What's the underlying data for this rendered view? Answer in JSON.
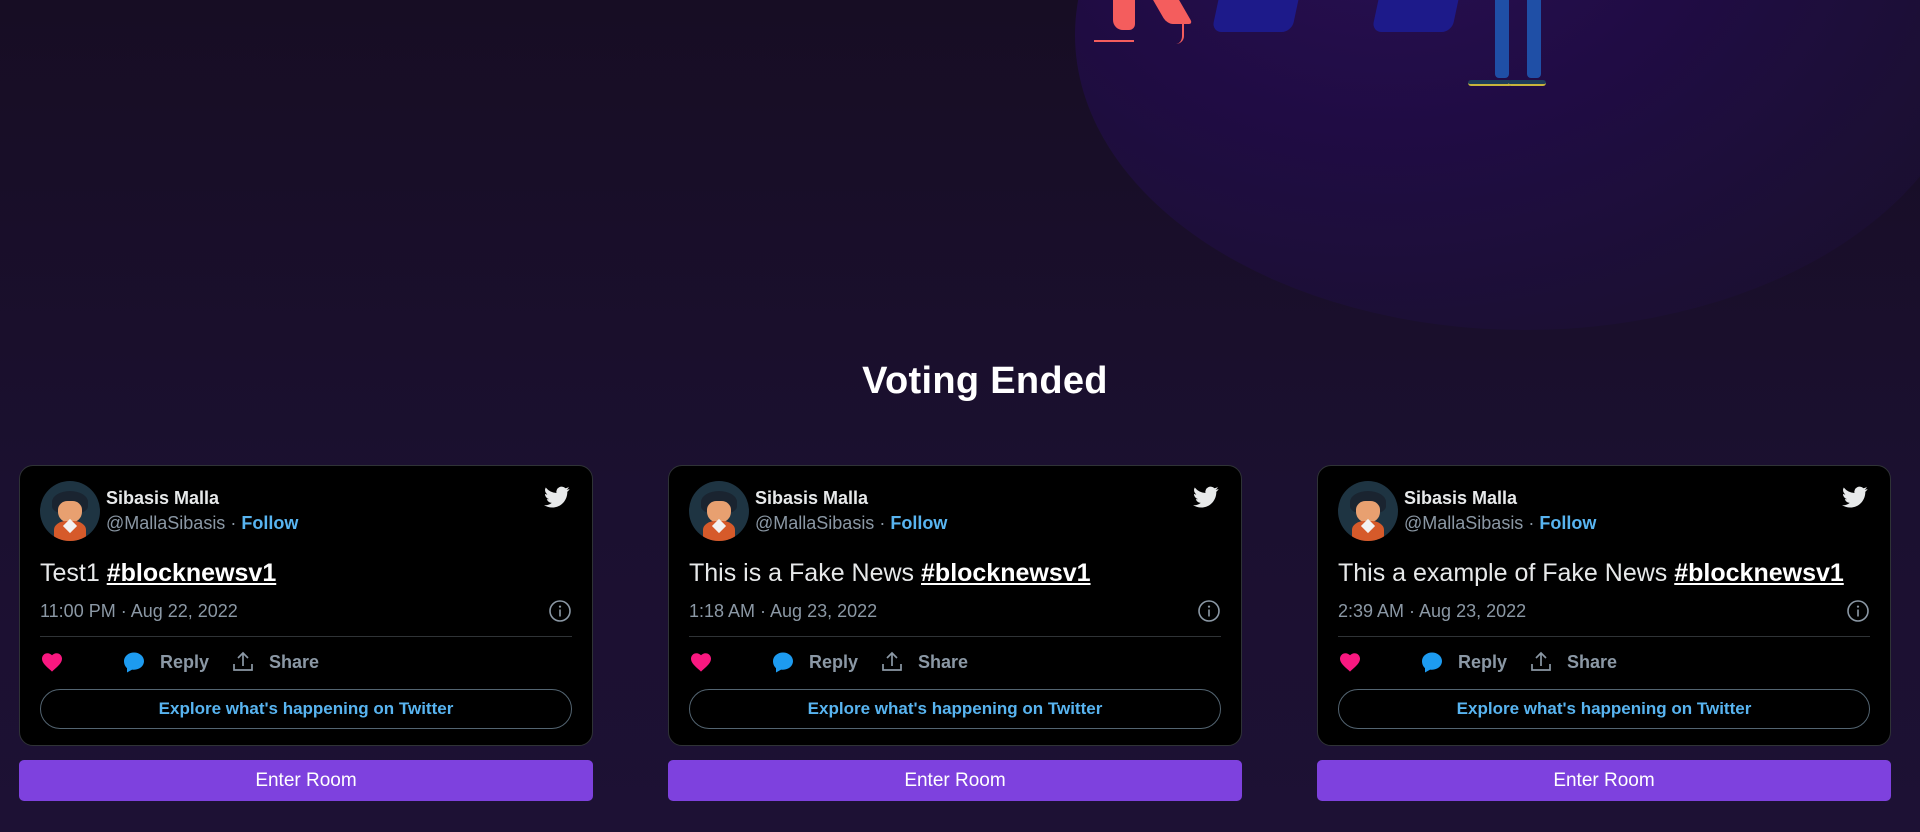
{
  "heading": "Voting Ended",
  "colors": {
    "background": "#1a1029",
    "tweet_bg": "#000000",
    "accent_button": "#7e41de",
    "link_blue": "#58b4f0",
    "heart_pink": "#f91880",
    "reply_blue": "#1d9bf0"
  },
  "tweets": [
    {
      "name": "Sibasis Malla",
      "handle": "@MallaSibasis",
      "separator": "·",
      "follow": "Follow",
      "text": "Test1 ",
      "hashtag": "#blocknewsv1",
      "time": "11:00 PM · Aug 22, 2022",
      "reply": "Reply",
      "share": "Share",
      "explore": "Explore what's happening on Twitter",
      "button": "Enter Room"
    },
    {
      "name": "Sibasis Malla",
      "handle": "@MallaSibasis",
      "separator": "·",
      "follow": "Follow",
      "text": "This is a Fake News ",
      "hashtag": "#blocknewsv1",
      "time": "1:18 AM · Aug 23, 2022",
      "reply": "Reply",
      "share": "Share",
      "explore": "Explore what's happening on Twitter",
      "button": "Enter Room"
    },
    {
      "name": "Sibasis Malla",
      "handle": "@MallaSibasis",
      "separator": "·",
      "follow": "Follow",
      "text": "This a example of Fake News ",
      "hashtag": "#blocknewsv1",
      "time": "2:39 AM · Aug 23, 2022",
      "reply": "Reply",
      "share": "Share",
      "explore": "Explore what's happening on Twitter",
      "button": "Enter Room"
    }
  ],
  "icons": {
    "brand": "twitter-bird-icon",
    "info": "info-icon",
    "like": "heart-icon",
    "reply": "speech-bubble-icon",
    "share": "share-upload-icon"
  }
}
